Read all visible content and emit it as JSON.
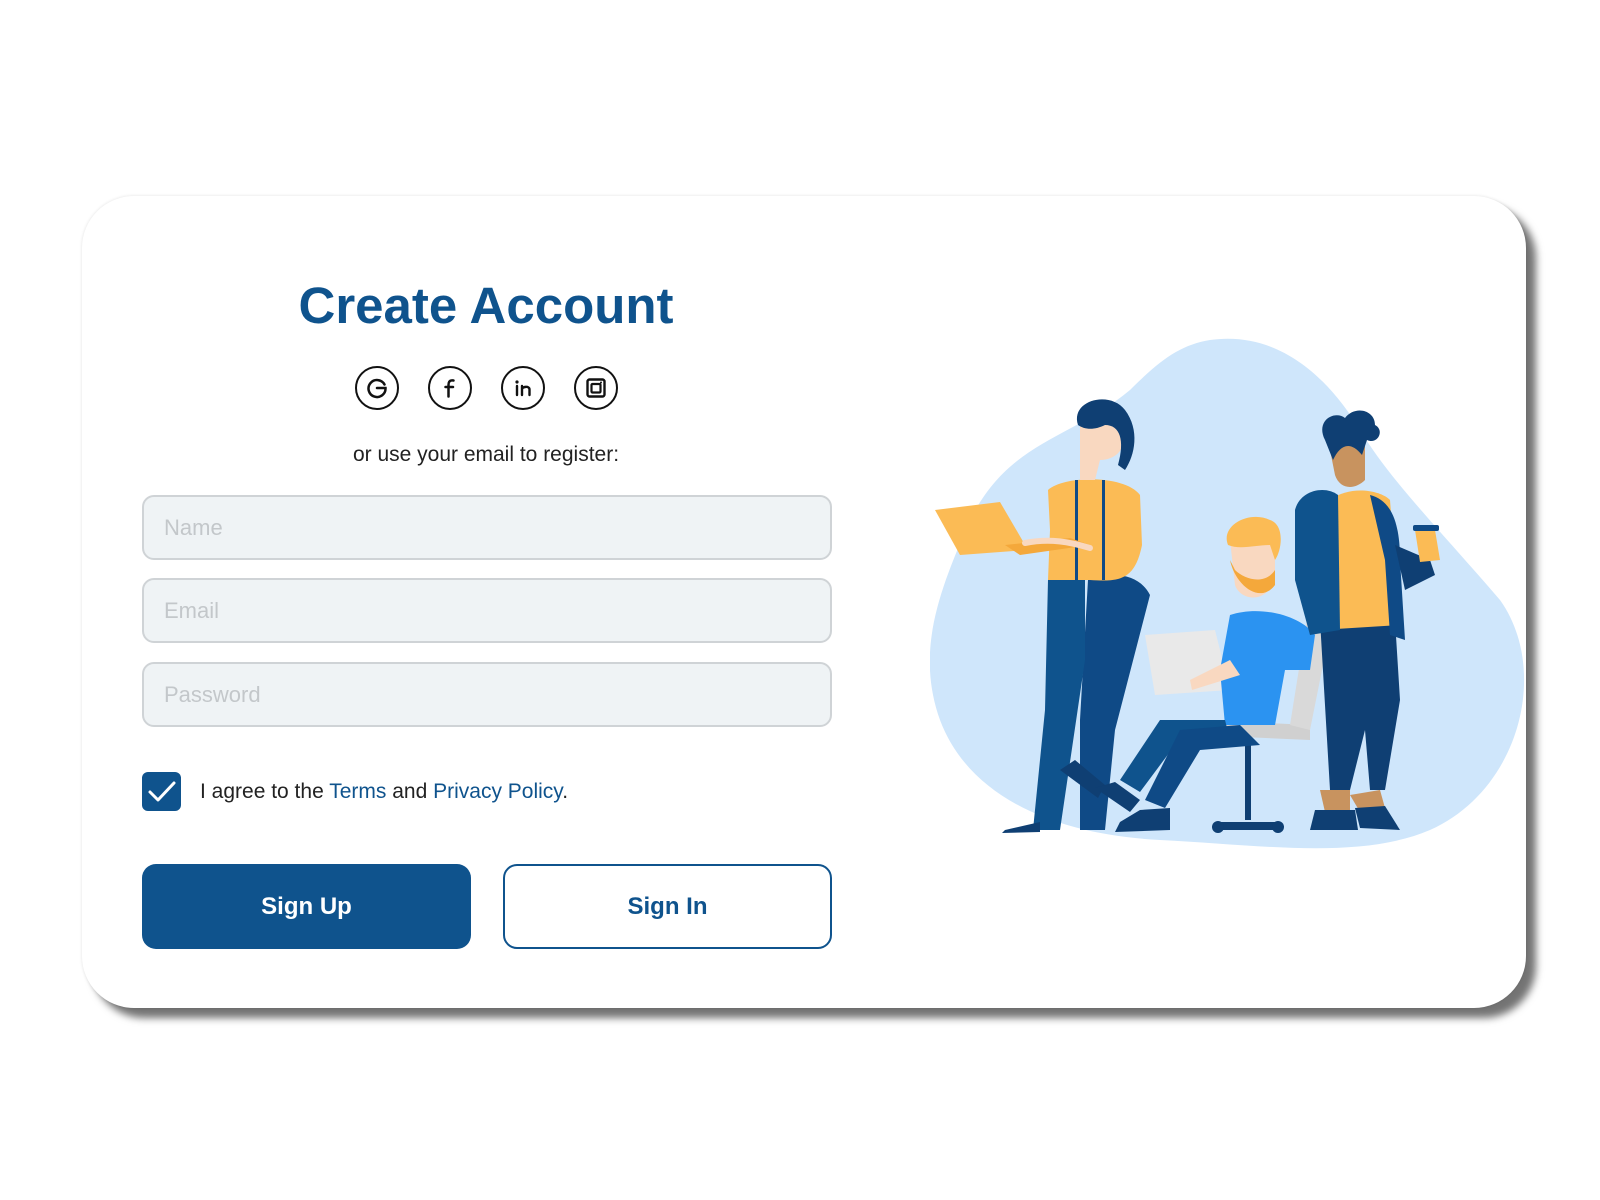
{
  "form": {
    "title": "Create Account",
    "subtitle": "or use your email to register:",
    "name_placeholder": "Name",
    "email_placeholder": "Email",
    "password_placeholder": "Password",
    "agree_prefix": "I agree to the ",
    "terms_label": "Terms",
    "agree_and": " and ",
    "privacy_label": "Privacy Policy",
    "agree_suffix": ".",
    "terms_checked": true,
    "signup_label": "Sign Up",
    "signin_label": "Sign In"
  },
  "social": [
    "google-icon",
    "facebook-icon",
    "linkedin-icon",
    "instagram-icon"
  ],
  "colors": {
    "primary": "#0f538d",
    "input_bg": "#eff3f5",
    "blob": "#cfe6fb",
    "accent_yellow": "#fbbb55",
    "shirt_blue": "#2b93f1"
  }
}
